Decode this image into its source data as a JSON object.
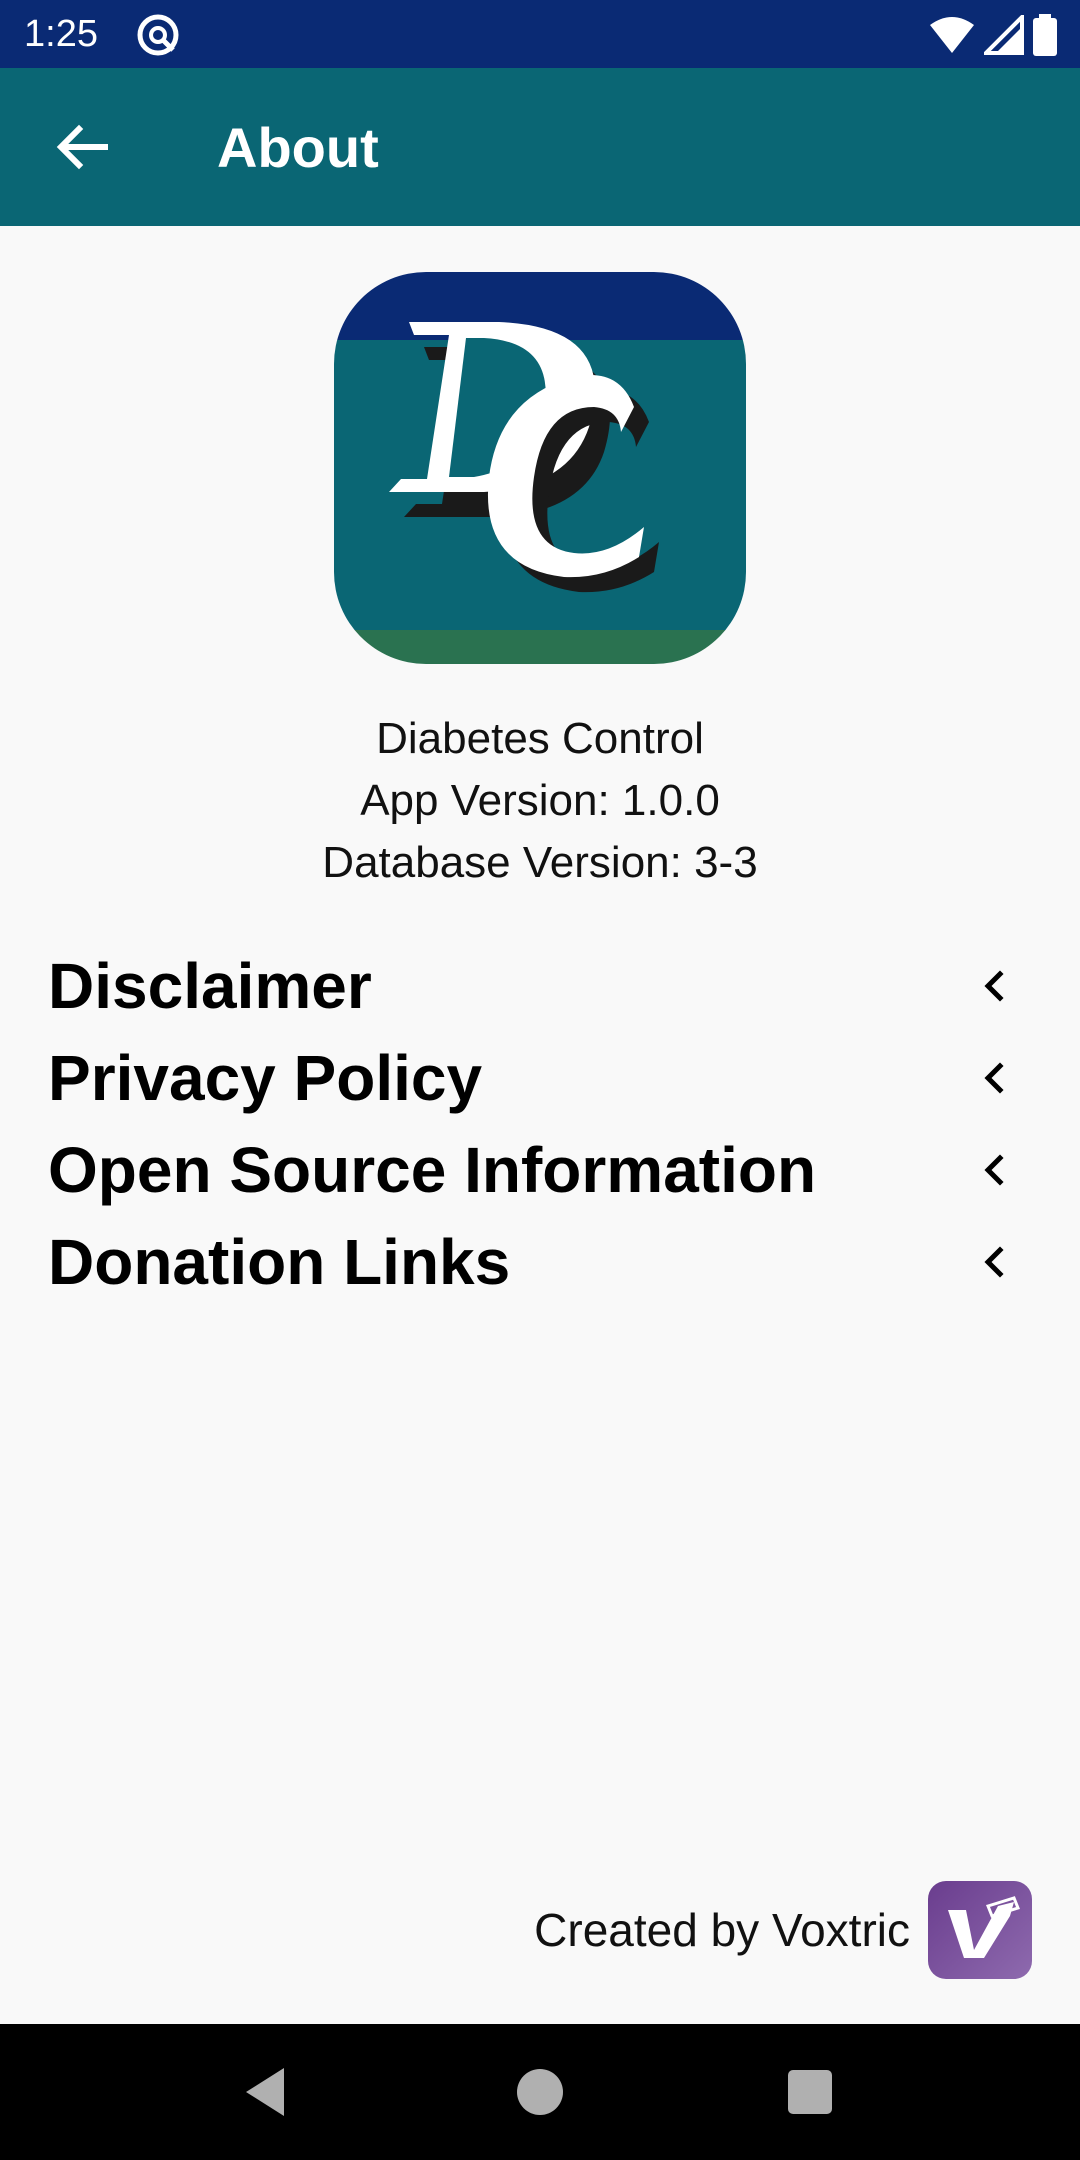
{
  "status_bar": {
    "time": "1:25"
  },
  "app_bar": {
    "title": "About"
  },
  "app_info": {
    "name": "Diabetes Control",
    "app_version": "App Version: 1.0.0",
    "db_version": "Database Version: 3-3"
  },
  "menu": [
    {
      "label": "Disclaimer"
    },
    {
      "label": "Privacy Policy"
    },
    {
      "label": "Open Source Information"
    },
    {
      "label": "Donation Links"
    }
  ],
  "footer": {
    "credit": "Created by Voxtric"
  },
  "icons": {
    "back": "arrow-left-icon",
    "chevron": "chevron-left-icon",
    "wifi": "wifi-icon",
    "signal": "signal-icon",
    "battery": "battery-icon"
  },
  "colors": {
    "status_bar": "#0A2A74",
    "app_bar": "#0A6674",
    "background": "#F9F9F9",
    "logo_top": "#0A2A74",
    "logo_mid": "#0A6674",
    "logo_bottom": "#2A7250",
    "voxtric_purple": "#6A3D8E"
  }
}
